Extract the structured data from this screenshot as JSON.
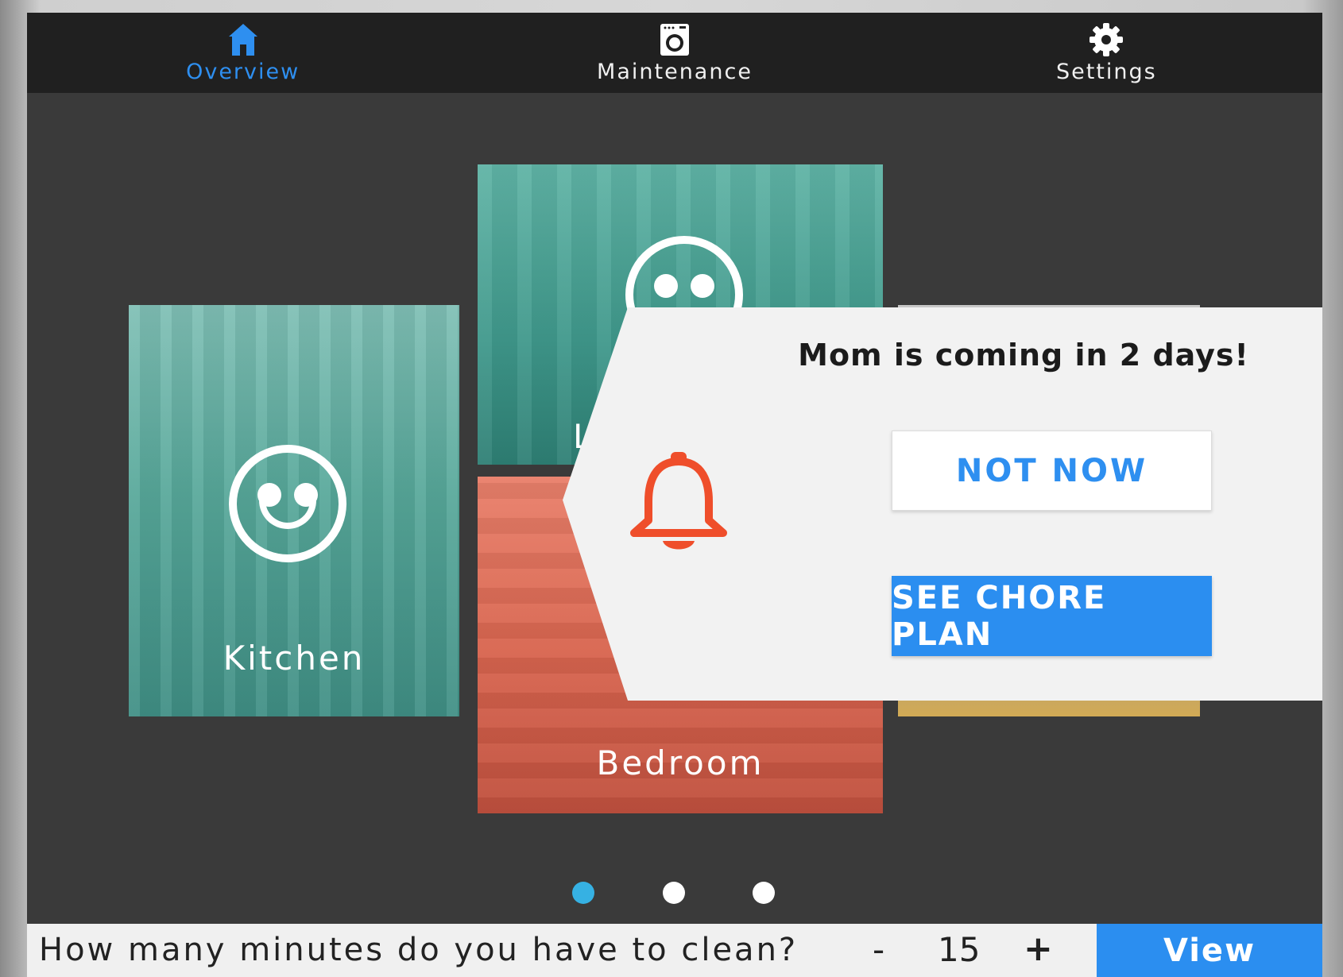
{
  "nav": {
    "items": [
      {
        "label": "Overview",
        "icon": "home-icon",
        "active": true
      },
      {
        "label": "Maintenance",
        "icon": "washing-machine-icon",
        "active": false
      },
      {
        "label": "Settings",
        "icon": "gear-icon",
        "active": false
      }
    ]
  },
  "rooms": [
    {
      "name": "Kitchen",
      "status_icon": "smiley-face-icon",
      "color": "#57a89a"
    },
    {
      "name": "L",
      "status_icon": "neutral-face-icon",
      "color": "#3e978a"
    },
    {
      "name": "Bedroom",
      "color": "#d96650"
    }
  ],
  "notification": {
    "message": "Mom is coming in 2 days!",
    "icon": "bell-icon",
    "icon_color": "#ef4e2b",
    "not_now_label": "NOT NOW",
    "see_plan_label": "SEE CHORE PLAN"
  },
  "pagination": {
    "count": 3,
    "active_index": 0,
    "active_color": "#36b1e3"
  },
  "bottom": {
    "question": "How many minutes do you have to clean?",
    "minus": "-",
    "minutes": "15",
    "plus": "+",
    "view_label": "View"
  },
  "colors": {
    "accent": "#2b8ef0",
    "nav_bg": "#202020",
    "app_bg": "#3a3a3a"
  }
}
